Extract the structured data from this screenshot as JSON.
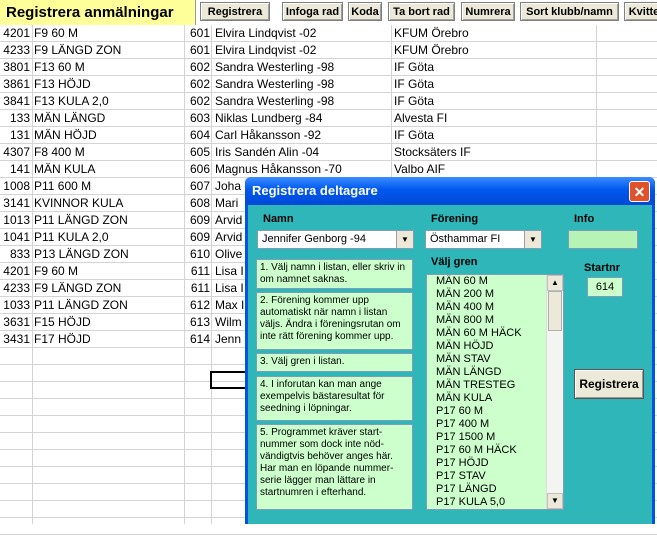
{
  "toolbar": {
    "title": "Registrera anmälningar",
    "buttons": [
      "Registrera",
      "Infoga rad",
      "Koda",
      "Ta bort rad",
      "Numrera",
      "Sort klubb/namn",
      "Kvitte"
    ]
  },
  "rows": [
    {
      "num": "4201",
      "event": "F9  60 M",
      "start": "601",
      "name": "Elvira Lindqvist -02",
      "club": "KFUM Örebro"
    },
    {
      "num": "4233",
      "event": "F9  LÄNGD ZON",
      "start": "601",
      "name": "Elvira Lindqvist -02",
      "club": "KFUM Örebro"
    },
    {
      "num": "3801",
      "event": "F13  60 M",
      "start": "602",
      "name": "Sandra Westerling -98",
      "club": "IF Göta"
    },
    {
      "num": "3861",
      "event": "F13  HÖJD",
      "start": "602",
      "name": "Sandra Westerling -98",
      "club": "IF Göta"
    },
    {
      "num": "3841",
      "event": "F13  KULA 2,0",
      "start": "602",
      "name": "Sandra Westerling -98",
      "club": "IF Göta"
    },
    {
      "num": "133",
      "event": "MÄN  LÄNGD",
      "start": "603",
      "name": "Niklas Lundberg -84",
      "club": "Alvesta FI"
    },
    {
      "num": "131",
      "event": "MÄN  HÖJD",
      "start": "604",
      "name": "Carl Håkansson -92",
      "club": "IF Göta"
    },
    {
      "num": "4307",
      "event": "F8  400 M",
      "start": "605",
      "name": "Iris Sandén Alin -04",
      "club": "Stocksäters IF"
    },
    {
      "num": "141",
      "event": "MÄN  KULA",
      "start": "606",
      "name": "Magnus Håkansson -70",
      "club": "Valbo AIF"
    },
    {
      "num": "1008",
      "event": "P11  600 M",
      "start": "607",
      "name": "Joha",
      "club": ""
    },
    {
      "num": "3141",
      "event": "KVINNOR  KULA",
      "start": "608",
      "name": "Mari",
      "club": ""
    },
    {
      "num": "1013",
      "event": "P11  LÄNGD ZON",
      "start": "609",
      "name": "Arvid",
      "club": ""
    },
    {
      "num": "1041",
      "event": "P11  KULA 2,0",
      "start": "609",
      "name": "Arvid",
      "club": ""
    },
    {
      "num": "833",
      "event": "P13  LÄNGD ZON",
      "start": "610",
      "name": "Olive",
      "club": ""
    },
    {
      "num": "4201",
      "event": "F9  60 M",
      "start": "611",
      "name": "Lisa I",
      "club": ""
    },
    {
      "num": "4233",
      "event": "F9  LÄNGD ZON",
      "start": "611",
      "name": "Lisa I",
      "club": ""
    },
    {
      "num": "1033",
      "event": "P11  LÄNGD ZON",
      "start": "612",
      "name": "Max I",
      "club": ""
    },
    {
      "num": "3631",
      "event": "F15  HÖJD",
      "start": "613",
      "name": "Wilm",
      "club": ""
    },
    {
      "num": "3431",
      "event": "F17  HÖJD",
      "start": "614",
      "name": "Jenn",
      "club": ""
    }
  ],
  "dialog": {
    "title": "Registrera deltagare",
    "close_label": "✕",
    "namn_label": "Namn",
    "namn_value": "Jennifer Genborg -94",
    "forening_label": "Förening",
    "forening_value": "Östhammar FI",
    "info_label": "Info",
    "info_value": "",
    "valj_gren_label": "Välj gren",
    "startnr_label": "Startnr",
    "startnr_value": "614",
    "registrera_label": "Registrera",
    "notes": [
      "1. Välj namn i listan, eller skriv in om namnet saknas.",
      "2. Förening kommer upp automatiskt när namn i listan väljs. Ändra i föreningsrutan om inte rätt förening kommer upp.",
      "3. Välj gren i listan.",
      "4. I inforutan kan man ange exempelvis bästaresultat för seedning i löpningar.",
      "5. Programmet kräver start-nummer som dock inte nöd-vändigtvis behöver anges här. Har man en löpande nummer-serie lägger man lättare in startnumren i efterhand."
    ],
    "events": [
      "MÄN  60 M",
      "MÄN  200 M",
      "MÄN  400 M",
      "MÄN  800 M",
      "MÄN  60 M HÄCK",
      "MÄN  HÖJD",
      "MÄN  STAV",
      "MÄN  LÄNGD",
      "MÄN  TRESTEG",
      "MÄN  KULA",
      "P17  60 M",
      "P17  400 M",
      "P17  1500 M",
      "P17  60 M HÄCK",
      "P17  HÖJD",
      "P17  STAV",
      "P17  LÄNGD",
      "P17  KULA 5,0"
    ]
  }
}
